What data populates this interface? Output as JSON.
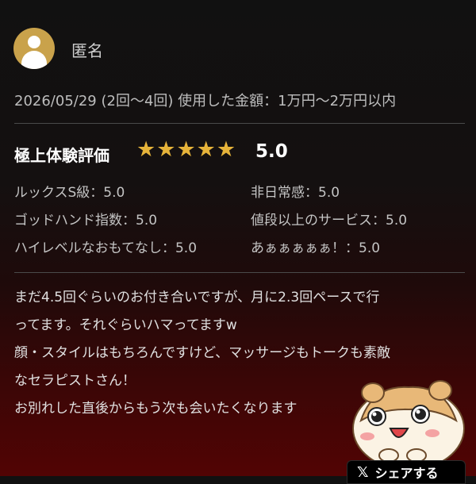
{
  "reviewer": {
    "name": "匿名",
    "avatar_icon": "user-icon"
  },
  "meta": {
    "date": "2026/05/29",
    "frequency": "(2回〜4回)",
    "amount_label": "使用した金額：1万円〜2万円以内"
  },
  "rating": {
    "title": "極上体験評価",
    "stars": 5,
    "value": "5.0",
    "star_color": "#e6b33a",
    "star_glyph": "★"
  },
  "sub_ratings": [
    {
      "label": "ルックスS級：5.0"
    },
    {
      "label": "非日常感：5.0"
    },
    {
      "label": "ゴッドハンド指数：5.0"
    },
    {
      "label": "値段以上のサービス：5.0"
    },
    {
      "label": "ハイレベルなおもてなし：5.0"
    },
    {
      "label": "あぁぁぁぁぁ！：5.0"
    }
  ],
  "body_lines": [
    "まだ4.5回ぐらいのお付き合いですが、月に2.3回ペースで行",
    "ってます。それぐらいハマってますw",
    "顔・スタイルはもちろんですけど、マッサージもトークも素敵",
    "なセラピストさん！",
    "お別れした直後からもう次も会いたくなります"
  ],
  "share": {
    "icon": "x-logo-icon",
    "label": "シェアする"
  }
}
